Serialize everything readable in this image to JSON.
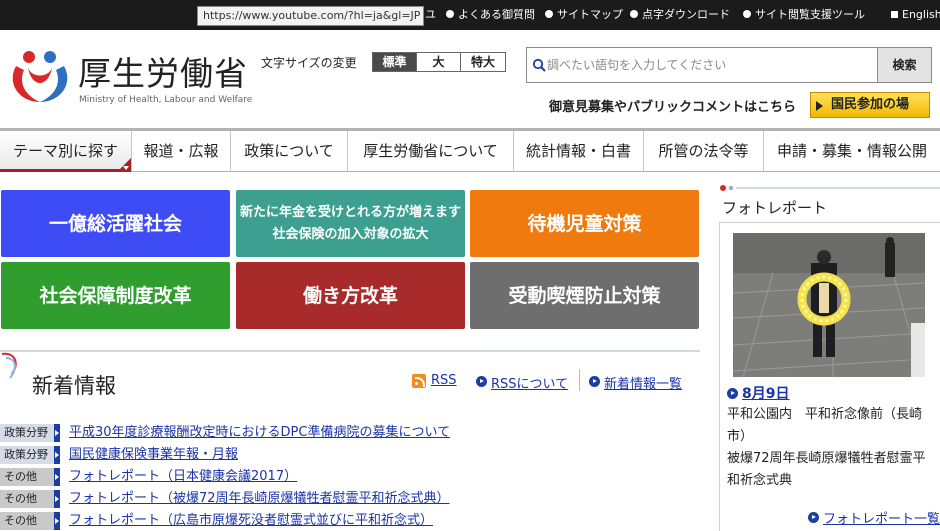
{
  "url_tooltip": "https://www.youtube.com/?hl=ja&gl=JP",
  "top_links": [
    {
      "label": "ユ"
    },
    {
      "label": "よくある御質問"
    },
    {
      "label": "サイトマップ"
    },
    {
      "label": "点字ダウンロード"
    },
    {
      "label": "サイト閲覧支援ツール"
    },
    {
      "label": "English"
    }
  ],
  "header": {
    "logo_jp": "厚生労働省",
    "logo_en": "Ministry of Health, Labour and Welfare",
    "font_size_label": "文字サイズの変更",
    "font_sizes": [
      "標準",
      "大",
      "特大"
    ],
    "search_placeholder": "調べたい語句を入力してください",
    "search_button": "検索",
    "opinion_text": "御意見募集やパブリックコメントはこちら",
    "participate_button": "国民参加の場"
  },
  "nav": [
    "テーマ別に探す",
    "報道・広報",
    "政策について",
    "厚生労働省について",
    "統計情報・白書",
    "所管の法令等",
    "申請・募集・情報公開"
  ],
  "tiles": [
    {
      "label": "一億総活躍社会",
      "color": "#3e4cf5"
    },
    {
      "label_lines": [
        "新たに年金を受けとれる方が増えます",
        "社会保険の加入対象の拡大"
      ],
      "color": "#3d9f8f"
    },
    {
      "label": "待機児童対策",
      "color": "#f07a0e"
    },
    {
      "label": "社会保障制度改革",
      "color": "#2f9e2f"
    },
    {
      "label": "働き方改革",
      "color": "#a82a2a"
    },
    {
      "label": "受動喫煙防止対策",
      "color": "#6e6e6e"
    }
  ],
  "news": {
    "title": "新着情報",
    "rss": "RSS",
    "rss_about": "RSSについて",
    "list_link": "新着情報一覧",
    "items": [
      {
        "tag": "政策分野",
        "text": "平成30年度診療報酬改定時におけるDPC準備病院の募集について"
      },
      {
        "tag": "政策分野",
        "text": "国民健康保険事業年報・月報"
      },
      {
        "tag": "その他",
        "text": "フォトレポート（日本健康会議2017）"
      },
      {
        "tag": "その他",
        "text": "フォトレポート（被爆72周年長崎原爆犠牲者慰霊平和祈念式典）"
      },
      {
        "tag": "その他",
        "text": "フォトレポート（広島市原爆死没者慰霊式並びに平和祈念式）"
      }
    ]
  },
  "photo_report": {
    "title": "フォトレポート",
    "date": "8月9日",
    "desc_lines": [
      "平和公園内　平和祈念像前（長崎市）",
      "被爆72周年長崎原爆犠牲者慰霊平和祈念式典"
    ],
    "more": "フォトレポート一覧"
  }
}
